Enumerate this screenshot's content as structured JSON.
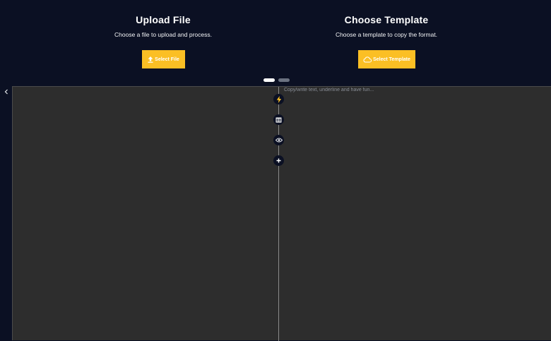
{
  "upload": {
    "title": "Upload File",
    "description": "Choose a file to upload and process.",
    "button_label": "Select File",
    "icon": "upload-icon"
  },
  "template": {
    "title": "Choose Template",
    "description": "Choose a template to copy the format.",
    "button_label": "Select Template",
    "icon": "cloud-icon"
  },
  "carousel": {
    "pages": 2,
    "active_index": 0
  },
  "sidebar": {
    "toggle_icon": "chevron-left-icon"
  },
  "editor": {
    "placeholder": "Copy/write text, underline and have fun..."
  },
  "toolbar": {
    "tools": [
      "lightning-icon",
      "table-icon",
      "eye-icon",
      "plus-icon"
    ]
  },
  "colors": {
    "accent": "#fbbf24",
    "header_bg": "#0b1023",
    "workspace_bg": "#2d2d2d",
    "tool_bg": "#0b1023"
  }
}
